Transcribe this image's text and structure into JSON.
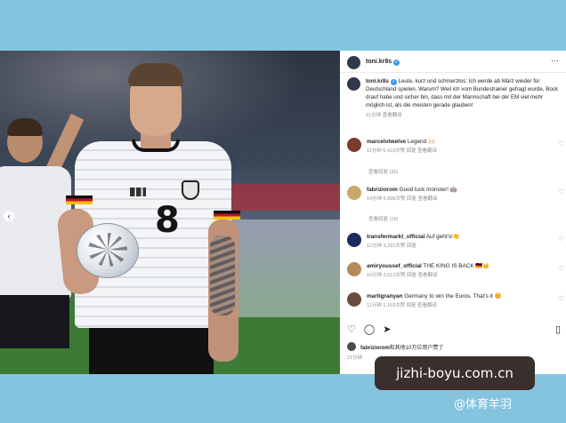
{
  "post": {
    "username": "toni.kr8s",
    "caption_user": "toni.kr8s",
    "caption": "Leute, kurz und schmerzlos: Ich werde ab März wieder für Deutschland spielen. Warum? Weil ich vom Bundestrainer gefragt wurde, Bock drauf habe und sicher bin, dass mit der Mannschaft bei der EM viel mehr möglich ist, als die meisten gerade glauben!",
    "caption_meta": "21分钟  查看翻译",
    "jersey_number": "8",
    "more_icon": "···",
    "carousel_prev_icon": "‹"
  },
  "comments": [
    {
      "user": "marcelotwelve",
      "text": "Legend 🙌🏻",
      "meta": "11分钟   5,410次赞   回复   查看翻译",
      "replies": "查看回复 (32)",
      "avatar_color": "#7a3b2e"
    },
    {
      "user": "fabriziorom",
      "text": "Good luck monster! 🤖",
      "meta": "14分钟   5,836次赞   回复   查看翻译",
      "replies": "查看回复 (19)",
      "avatar_color": "#c9a86a"
    },
    {
      "user": "transfermarkt_official",
      "text": "Auf geht's!👏",
      "meta": "12分钟   3,331次赞   回复",
      "replies": "",
      "avatar_color": "#1a2d5c"
    },
    {
      "user": "amiryoussef_official",
      "text": "THE KING IS BACK 🇩🇪👑",
      "meta": "16分钟   2,013次赞   回复   查看翻译",
      "replies": "",
      "avatar_color": "#b58a5a"
    },
    {
      "user": "martigranyan",
      "text": "Germany to win the Euros. That's it 😊",
      "meta": "11分钟   1,163次赞   回复   查看翻译",
      "replies": "",
      "avatar_color": "#6b4b3a"
    }
  ],
  "actions": {
    "like_icon": "♡",
    "comment_icon": "◯",
    "share_icon": "➤",
    "bookmark_icon": "▯",
    "heart_icon": "♡"
  },
  "likes": {
    "user": "fabriziorom",
    "text": "和其他10万位用户赞了",
    "time": "21分钟"
  },
  "overlay": {
    "url": "jizhi-boyu.com.cn",
    "watermark": "@体育羊羽"
  }
}
